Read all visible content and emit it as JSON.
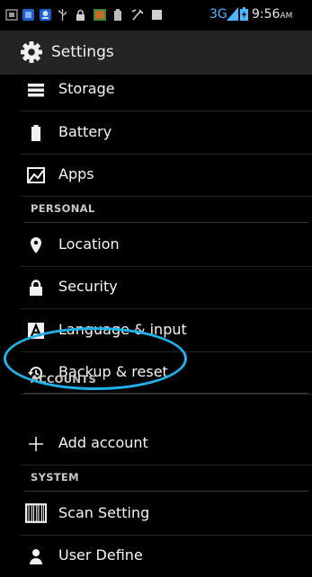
{
  "status_bar": {
    "network": "3G",
    "time": "9:56",
    "ampm": "AM",
    "icons": [
      "sim-icon",
      "notification-icon",
      "app-icon",
      "usb-icon",
      "lock-icon",
      "photo-icon",
      "battery-icon",
      "wrench-icon",
      "stop-icon",
      "signal-icon",
      "battery-charging-icon"
    ]
  },
  "header": {
    "title": "Settings",
    "icon": "gear-icon"
  },
  "items": {
    "storage": "Storage",
    "battery": "Battery",
    "apps": "Apps",
    "location": "Location",
    "security": "Security",
    "language": "Language & input",
    "backup": "Backup & reset",
    "add_account": "Add account",
    "scan_setting": "Scan Setting",
    "user_define": "User Define"
  },
  "sections": {
    "personal": "PERSONAL",
    "accounts": "ACCOUNTS",
    "system": "SYSTEM"
  },
  "colors": {
    "background": "#000000",
    "action_bar": "#222425",
    "highlight": "#1fb2e8",
    "network_text": "#4db8ff"
  }
}
